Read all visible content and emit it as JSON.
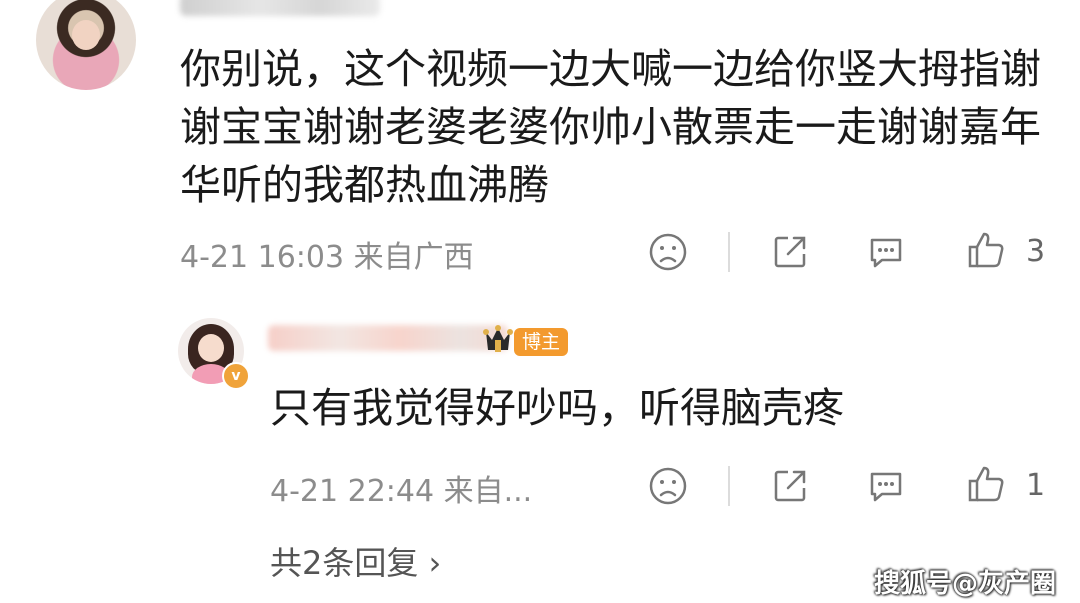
{
  "comment": {
    "text": "你别说，这个视频一边大喊一边给你竖大拇指谢谢宝宝谢谢老婆老婆你帅小散票走一走谢谢嘉年华听的我都热血沸腾",
    "timestamp": "4-21 16:03 来自广西",
    "like_count": "3",
    "icons": [
      "sad-face-icon",
      "share-icon",
      "comment-icon",
      "thumbs-up-icon"
    ]
  },
  "reply": {
    "badge": "博主",
    "text": "只有我觉得好吵吗，听得脑壳疼",
    "timestamp": "4-21 22:44 来自...",
    "like_count": "1",
    "verified_mark": "v"
  },
  "more_replies": {
    "label": "共2条回复 ›"
  },
  "watermark": {
    "text": "搜狐号@灰产圈"
  },
  "colors": {
    "text": "#1a1a1a",
    "meta": "#8c8c8c",
    "badge": "#f39a2e"
  }
}
